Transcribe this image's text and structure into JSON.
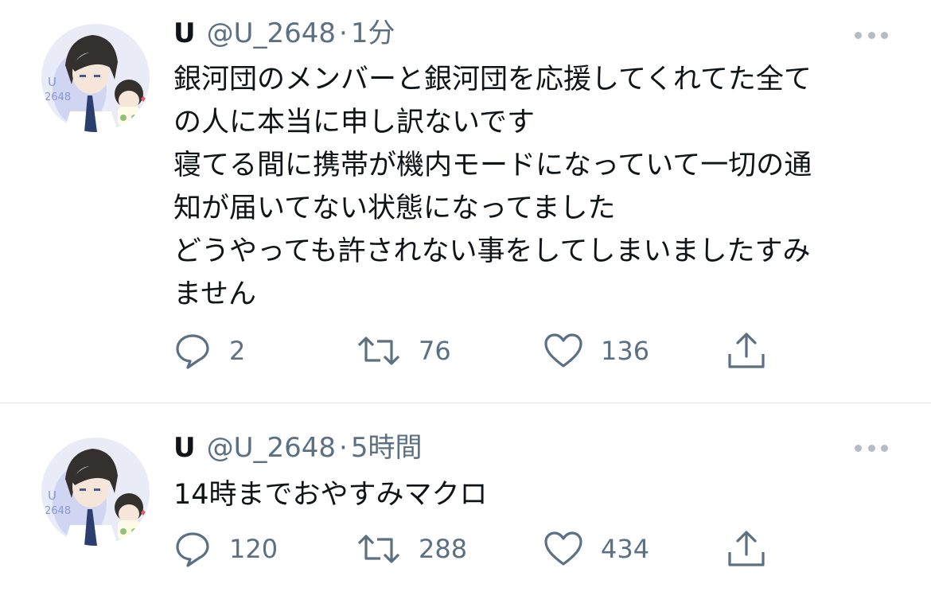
{
  "tweets": [
    {
      "name": "U",
      "handle": "@U_2648",
      "separator": "·",
      "time": "1分",
      "text": "銀河団のメンバーと銀河団を応援してくれてた全て\nの人に本当に申し訳ないです\n寝てる間に携帯が機内モードになっていて一切の通\n知が届いてない状態になってました\nどうやっても許されない事をしてしまいましたすみ\nません",
      "replies": "2",
      "retweets": "76",
      "likes": "136"
    },
    {
      "name": "U",
      "handle": "@U_2648",
      "separator": "·",
      "time": "5時間",
      "text": "14時までおやすみマクロ",
      "replies": "120",
      "retweets": "288",
      "likes": "434"
    }
  ],
  "icons": {
    "more": "more-horizontal-icon",
    "reply": "reply-bubble-icon",
    "retweet": "retweet-arrows-icon",
    "like": "heart-icon",
    "share": "share-upload-icon"
  },
  "colors": {
    "text": "#0f1419",
    "secondary": "#5b7083",
    "icon": "#5b7083",
    "divider": "#dfe3e6"
  },
  "avatar": {
    "label": "U\n2648"
  }
}
